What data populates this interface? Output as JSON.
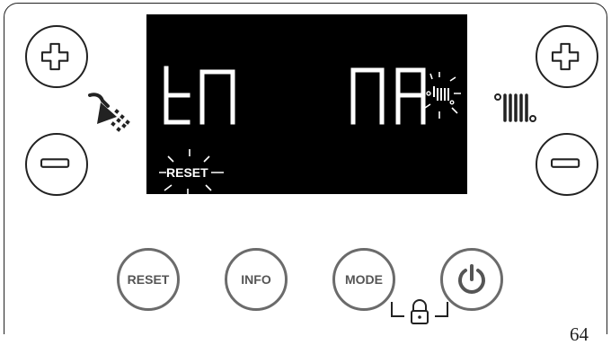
{
  "display": {
    "left_text": "tn",
    "right_text": "nA",
    "reset_indicator": "RESET"
  },
  "buttons": {
    "dhw_plus": "plus-icon",
    "dhw_minus": "minus-icon",
    "ch_plus": "plus-icon",
    "ch_minus": "minus-icon",
    "reset_label": "RESET",
    "info_label": "INFO",
    "mode_label": "MODE",
    "power": "power-icon"
  },
  "icons": {
    "dhw": "shower-icon",
    "heating": "radiator-icon",
    "lock": "padlock-icon"
  },
  "page_number": "64"
}
